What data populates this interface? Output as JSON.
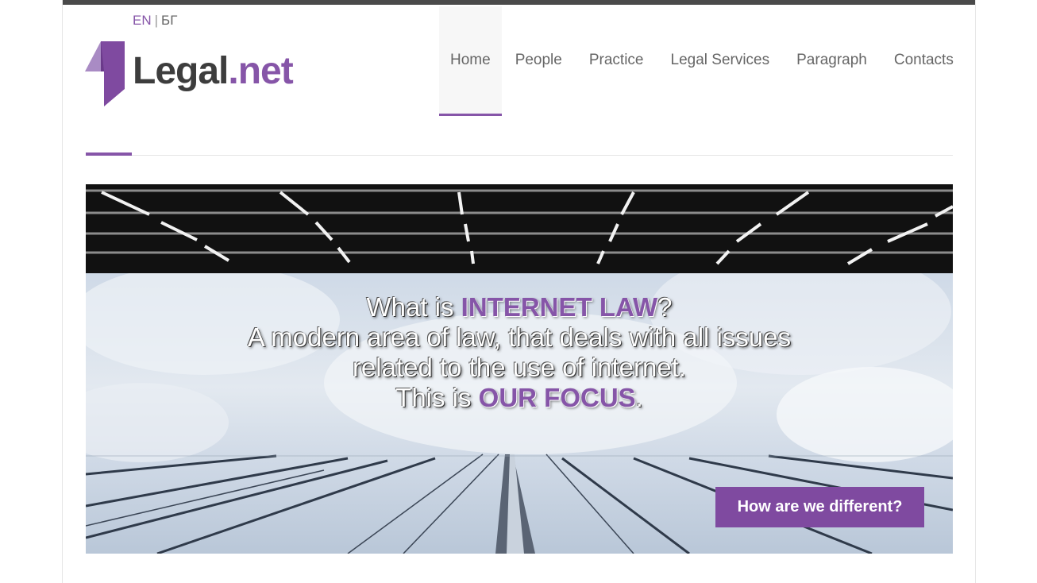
{
  "lang_switch": {
    "en": "EN",
    "separator": "|",
    "bg": "БГ"
  },
  "logo": {
    "text_main": "Legal",
    "text_accent": ".net"
  },
  "nav": [
    {
      "label": "Home",
      "active": true
    },
    {
      "label": "People"
    },
    {
      "label": "Practice"
    },
    {
      "label": "Legal Services"
    },
    {
      "label": "Paragraph"
    },
    {
      "label": "Contacts"
    }
  ],
  "hero": {
    "line1_pre": "What is ",
    "line1_strong": "INTERNET LAW",
    "line1_post": "?",
    "line2": "A modern area of law, that deals with all issues",
    "line3": "related to the use of internet.",
    "line4_pre": "This is ",
    "line4_strong": "OUR FOCUS",
    "line4_post": ".",
    "cta_label": "How are we different?"
  },
  "colors": {
    "accent": "#8655a8",
    "top_bar": "#4a4a4a",
    "text": "#666666"
  }
}
